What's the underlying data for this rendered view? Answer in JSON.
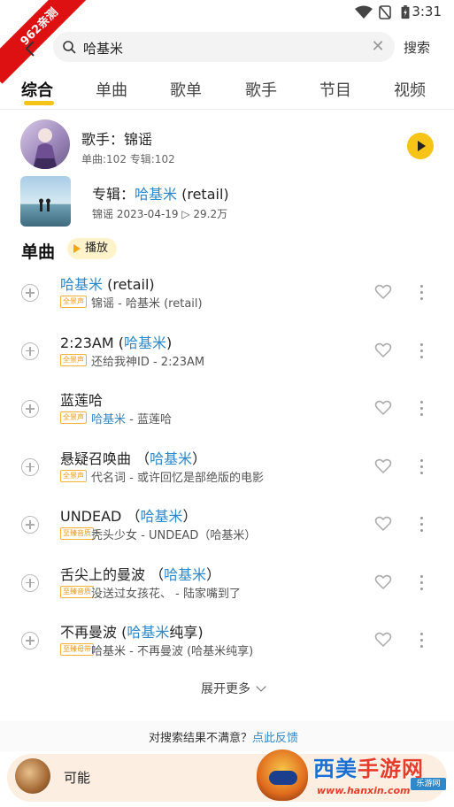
{
  "status_bar": {
    "time": "3:31",
    "icons": [
      "wifi-icon",
      "no-sim-icon",
      "battery-icon"
    ]
  },
  "watermark_ribbon": "962亲测",
  "search": {
    "value": "哈基米",
    "button_label": "搜索"
  },
  "tabs": [
    {
      "label": "综合",
      "active": true
    },
    {
      "label": "单曲",
      "active": false
    },
    {
      "label": "歌单",
      "active": false
    },
    {
      "label": "歌手",
      "active": false
    },
    {
      "label": "节目",
      "active": false
    },
    {
      "label": "视频",
      "active": false
    }
  ],
  "artist": {
    "title": "歌手：锦谣",
    "meta": "单曲:102  专辑:102"
  },
  "album": {
    "label_prefix": "专辑：",
    "name_highlight": "哈基米",
    "name_rest": " (retail)",
    "meta": "锦谣  2023-04-19  ▷ 29.2万"
  },
  "songs_section": {
    "title": "单曲",
    "play_label": "播放"
  },
  "songs": [
    {
      "name_pre": "",
      "name_hl": "哈基米",
      "name_post": " (retail)",
      "badge": "全景声",
      "sub_pre": "锦谣 - 哈基米 (retail)",
      "sub_hl": "",
      "sub_post": ""
    },
    {
      "name_pre": "2:23AM (",
      "name_hl": "哈基米",
      "name_post": ")",
      "badge": "全景声",
      "sub_pre": "还给我神ID - 2:23AM",
      "sub_hl": "",
      "sub_post": ""
    },
    {
      "name_pre": "蓝莲哈",
      "name_hl": "",
      "name_post": "",
      "badge": "全景声",
      "sub_pre": "",
      "sub_hl": "哈基米",
      "sub_post": " - 蓝莲哈"
    },
    {
      "name_pre": "悬疑召唤曲 （",
      "name_hl": "哈基米",
      "name_post": "）",
      "badge": "全景声",
      "sub_pre": "代名词 - 或许回忆是部绝版的电影",
      "sub_hl": "",
      "sub_post": ""
    },
    {
      "name_pre": "UNDEAD （",
      "name_hl": "哈基米",
      "name_post": "）",
      "badge": "至臻音质",
      "sub_pre": "秃头少女 - UNDEAD（哈基米）",
      "sub_hl": "",
      "sub_post": ""
    },
    {
      "name_pre": "舌尖上的曼波 （",
      "name_hl": "哈基米",
      "name_post": "）",
      "badge": "至臻音质",
      "sub_pre": "没送过女孩花、 - 陆家嘴到了",
      "sub_hl": "",
      "sub_post": ""
    },
    {
      "name_pre": "不再曼波 (",
      "name_hl": "哈基米",
      "name_post": "纯享)",
      "badge": "至臻母带",
      "sub_pre": "哈基米 - 不再曼波 (哈基米纯享)",
      "sub_hl": "",
      "sub_post": ""
    }
  ],
  "expand_label": "展开更多",
  "feedback": {
    "text": "对搜索结果不满意？",
    "link": "点此反馈"
  },
  "player": {
    "title": "可能"
  },
  "logo": {
    "brand_blue": "西美",
    "brand_red": "手游网",
    "site": "www.hanxin.com",
    "tag": "乐游网"
  },
  "colors": {
    "accent": "#f6c416",
    "highlight": "#2f88c9"
  }
}
